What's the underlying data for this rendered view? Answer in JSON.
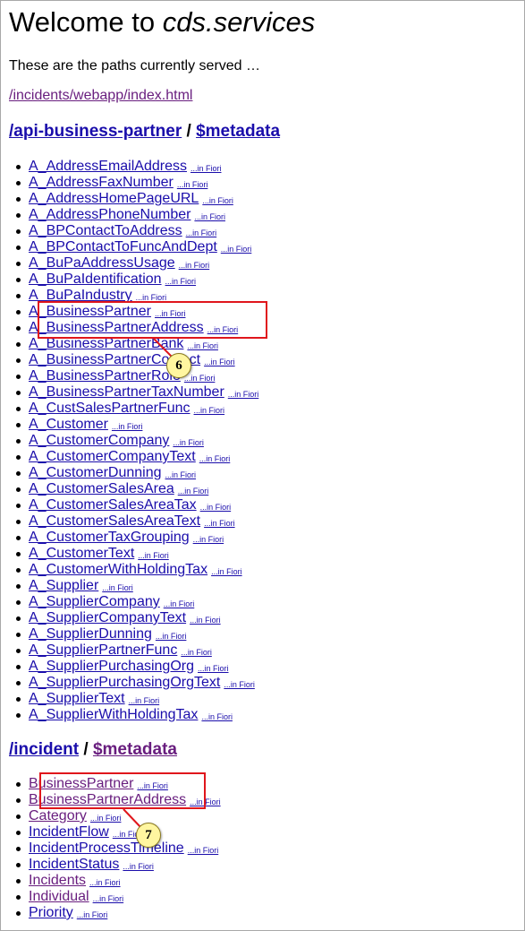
{
  "header": {
    "welcome_prefix": "Welcome to ",
    "welcome_service": "cds.services",
    "intro": "These are the paths currently served …",
    "app_link": "/incidents/webapp/index.html"
  },
  "sections": [
    {
      "path": "/api-business-partner",
      "separator": "/",
      "metadata": "$metadata",
      "entities": [
        {
          "name": "A_AddressEmailAddress",
          "fiori": "...in Fiori"
        },
        {
          "name": "A_AddressFaxNumber",
          "fiori": "...in Fiori"
        },
        {
          "name": "A_AddressHomePageURL",
          "fiori": "...in Fiori"
        },
        {
          "name": "A_AddressPhoneNumber",
          "fiori": "...in Fiori"
        },
        {
          "name": "A_BPContactToAddress",
          "fiori": "...in Fiori"
        },
        {
          "name": "A_BPContactToFuncAndDept",
          "fiori": "...in Fiori"
        },
        {
          "name": "A_BuPaAddressUsage",
          "fiori": "...in Fiori"
        },
        {
          "name": "A_BuPaIdentification",
          "fiori": "...in Fiori"
        },
        {
          "name": "A_BuPaIndustry",
          "fiori": "...in Fiori"
        },
        {
          "name": "A_BusinessPartner",
          "fiori": "...in Fiori"
        },
        {
          "name": "A_BusinessPartnerAddress",
          "fiori": "...in Fiori"
        },
        {
          "name": "A_BusinessPartnerBank",
          "fiori": "...in Fiori"
        },
        {
          "name": "A_BusinessPartnerContact",
          "fiori": "...in Fiori"
        },
        {
          "name": "A_BusinessPartnerRole",
          "fiori": "...in Fiori"
        },
        {
          "name": "A_BusinessPartnerTaxNumber",
          "fiori": "...in Fiori"
        },
        {
          "name": "A_CustSalesPartnerFunc",
          "fiori": "...in Fiori"
        },
        {
          "name": "A_Customer",
          "fiori": "...in Fiori"
        },
        {
          "name": "A_CustomerCompany",
          "fiori": "...in Fiori"
        },
        {
          "name": "A_CustomerCompanyText",
          "fiori": "...in Fiori"
        },
        {
          "name": "A_CustomerDunning",
          "fiori": "...in Fiori"
        },
        {
          "name": "A_CustomerSalesArea",
          "fiori": "...in Fiori"
        },
        {
          "name": "A_CustomerSalesAreaTax",
          "fiori": "...in Fiori"
        },
        {
          "name": "A_CustomerSalesAreaText",
          "fiori": "...in Fiori"
        },
        {
          "name": "A_CustomerTaxGrouping",
          "fiori": "...in Fiori"
        },
        {
          "name": "A_CustomerText",
          "fiori": "...in Fiori"
        },
        {
          "name": "A_CustomerWithHoldingTax",
          "fiori": "...in Fiori"
        },
        {
          "name": "A_Supplier",
          "fiori": "...in Fiori"
        },
        {
          "name": "A_SupplierCompany",
          "fiori": "...in Fiori"
        },
        {
          "name": "A_SupplierCompanyText",
          "fiori": "...in Fiori"
        },
        {
          "name": "A_SupplierDunning",
          "fiori": "...in Fiori"
        },
        {
          "name": "A_SupplierPartnerFunc",
          "fiori": "...in Fiori"
        },
        {
          "name": "A_SupplierPurchasingOrg",
          "fiori": "...in Fiori"
        },
        {
          "name": "A_SupplierPurchasingOrgText",
          "fiori": "...in Fiori"
        },
        {
          "name": "A_SupplierText",
          "fiori": "...in Fiori"
        },
        {
          "name": "A_SupplierWithHoldingTax",
          "fiori": "...in Fiori"
        }
      ]
    },
    {
      "path": "/incident",
      "separator": "/",
      "metadata": "$metadata",
      "entities": [
        {
          "name": "BusinessPartner",
          "fiori": "...in Fiori"
        },
        {
          "name": "BusinessPartnerAddress",
          "fiori": "...in Fiori"
        },
        {
          "name": "Category",
          "fiori": "...in Fiori"
        },
        {
          "name": "IncidentFlow",
          "fiori": "...in Fiori"
        },
        {
          "name": "IncidentProcessTimeline",
          "fiori": "...in Fiori"
        },
        {
          "name": "IncidentStatus",
          "fiori": "...in Fiori"
        },
        {
          "name": "Incidents",
          "fiori": "...in Fiori"
        },
        {
          "name": "Individual",
          "fiori": "...in Fiori"
        },
        {
          "name": "Priority",
          "fiori": "...in Fiori"
        }
      ]
    }
  ],
  "annotations": [
    {
      "label": "6"
    },
    {
      "label": "7"
    }
  ],
  "colors": {
    "link": "#1a0dab",
    "visited": "#681d7e",
    "highlight": "#e0161c",
    "callout_fill": "#fff6a0"
  }
}
